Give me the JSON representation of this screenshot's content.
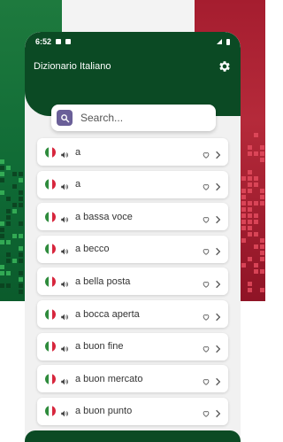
{
  "app": {
    "title": "Dizionario Italiano"
  },
  "statusbar": {
    "time": "6:52"
  },
  "search": {
    "placeholder": "Search..."
  },
  "icons": {
    "gear": "gear-icon",
    "search": "search-icon",
    "flag": "italian-flag-icon",
    "speaker": "speaker-icon",
    "favorite": "heart-icon",
    "chevron": "chevron-right-icon"
  },
  "colors": {
    "header_green": "#0b4a24",
    "search_icon_bg": "#6a5f98",
    "flag_green": "#2e8b3c",
    "flag_white": "#ffffff",
    "flag_red": "#d7263d"
  },
  "entries": [
    {
      "word": "a"
    },
    {
      "word": "a"
    },
    {
      "word": "a bassa voce"
    },
    {
      "word": "a becco"
    },
    {
      "word": "a bella posta"
    },
    {
      "word": "a bocca aperta"
    },
    {
      "word": "a buon fine"
    },
    {
      "word": "a buon mercato"
    },
    {
      "word": "a buon punto"
    }
  ]
}
